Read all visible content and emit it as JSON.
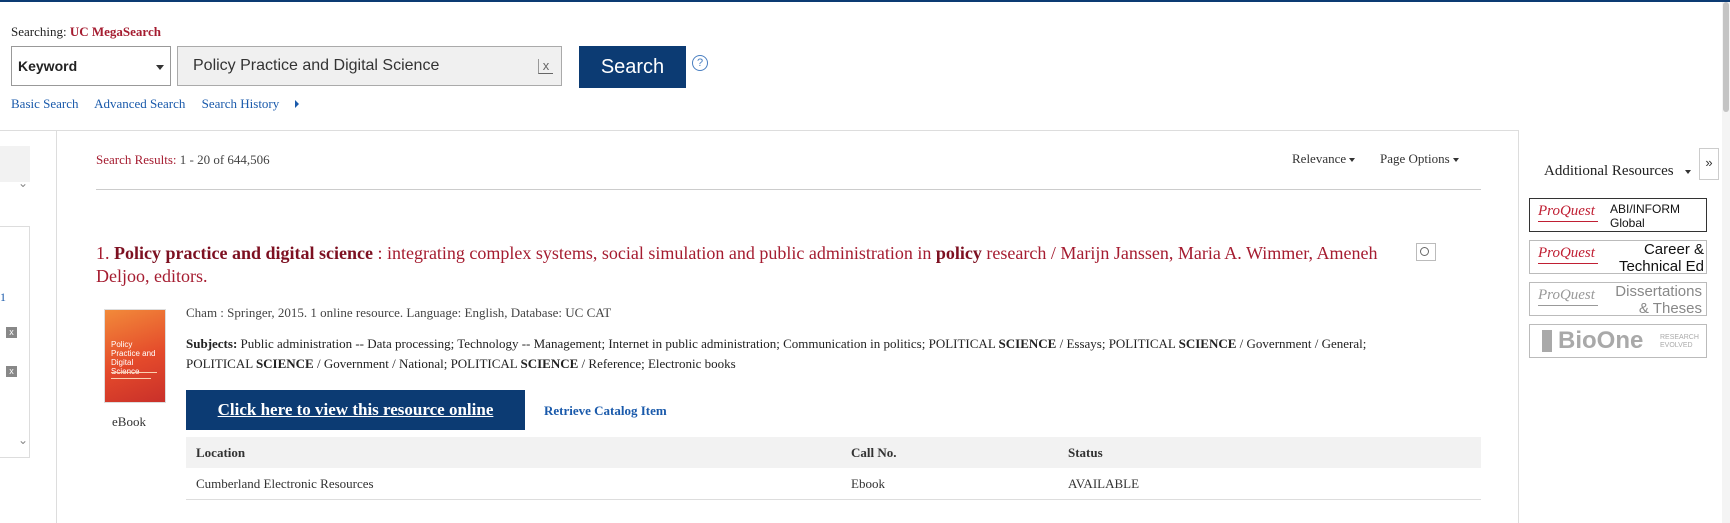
{
  "header": {
    "searching_label": "Searching:",
    "database": "UC MegaSearch",
    "search_type": "Keyword",
    "query": "Policy Practice and Digital Science",
    "clear_glyph": "x",
    "search_button": "Search",
    "help_glyph": "?",
    "links": [
      "Basic Search",
      "Advanced Search",
      "Search History"
    ]
  },
  "left_panel": {
    "number": "1",
    "x_glyph": "x",
    "chevron": "⌄"
  },
  "results": {
    "label": "Search Results:",
    "count": "1 - 20 of 644,506",
    "sort": "Relevance",
    "page_options": "Page Options"
  },
  "result": {
    "number": "1.",
    "title_bold_1": "Policy practice and digital science",
    "title_part_1": " : integrating complex systems, social simulation and public administration in ",
    "title_bold_2": "policy",
    "title_part_2": " research / Marijn Janssen, Maria A. Wimmer, Ameneh Deljoo, editors.",
    "cover_title": "Policy Practice and Digital Science",
    "format": "eBook",
    "publication": "Cham : Springer, 2015. 1 online resource. Language: English, Database: UC CAT",
    "subjects_label": "Subjects:",
    "subjects_1": " Public administration -- Data processing; Technology -- Management; Internet in public administration; Communication in politics; POLITICAL ",
    "subjects_b1": "SCIENCE",
    "subjects_2": " / Essays; POLITICAL ",
    "subjects_b2": "SCIENCE",
    "subjects_3": " / Government / General; POLITICAL ",
    "subjects_b3": "SCIENCE",
    "subjects_4": " / Government / National; POLITICAL ",
    "subjects_b4": "SCIENCE",
    "subjects_5": " / Reference; Electronic books",
    "view_online": "Click here to view this resource online",
    "retrieve": "Retrieve Catalog Item",
    "holdings": {
      "headers": [
        "Location",
        "Call No.",
        "Status"
      ],
      "rows": [
        [
          "Cumberland Electronic Resources",
          "Ebook",
          "AVAILABLE"
        ]
      ]
    }
  },
  "right_panel": {
    "collapse_glyph": "»",
    "title": "Additional Resources",
    "resources": [
      {
        "brand": "ProQuest",
        "name": "ABI/INFORM Global"
      },
      {
        "brand": "ProQuest",
        "name": "Career & Technical Ed"
      },
      {
        "brand": "ProQuest",
        "name": "Dissertations & Theses"
      },
      {
        "brand": "BioOne",
        "name": "RESEARCH EVOLVED"
      }
    ]
  },
  "colors": {
    "primary_navy": "#0c3b73",
    "title_red": "#a51c30",
    "link_blue": "#1a5aab"
  }
}
